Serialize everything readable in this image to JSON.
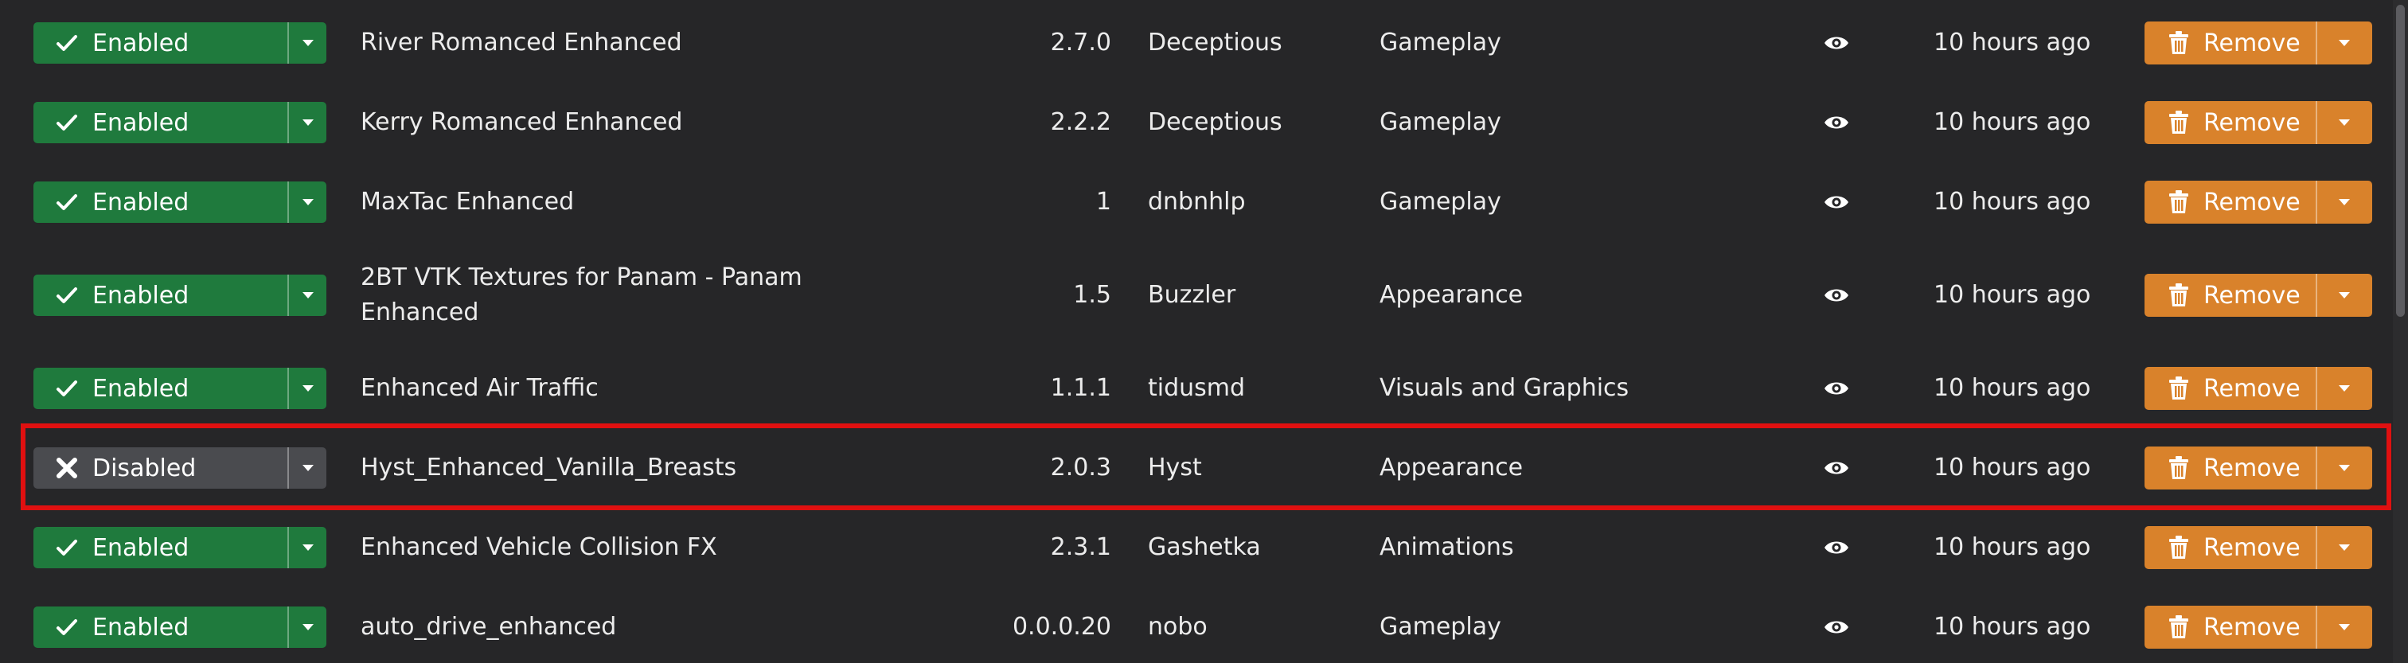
{
  "colors": {
    "background": "#262628",
    "enabled_green": "#1f7a3d",
    "disabled_gray": "#4a4b4f",
    "remove_orange": "#d9822b",
    "highlight_red": "#e01010"
  },
  "actions": {
    "remove_label": "Remove"
  },
  "mods": [
    {
      "status": "Enabled",
      "name": "River Romanced Enhanced",
      "version": "2.7.0",
      "author": "Deceptious",
      "category": "Gameplay",
      "updated": "10 hours ago"
    },
    {
      "status": "Enabled",
      "name": "Kerry Romanced Enhanced",
      "version": "2.2.2",
      "author": "Deceptious",
      "category": "Gameplay",
      "updated": "10 hours ago"
    },
    {
      "status": "Enabled",
      "name": "MaxTac Enhanced",
      "version": "1",
      "author": "dnbnhlp",
      "category": "Gameplay",
      "updated": "10 hours ago"
    },
    {
      "status": "Enabled",
      "name": "2BT VTK Textures for Panam - Panam Enhanced",
      "version": "1.5",
      "author": "Buzzler",
      "category": "Appearance",
      "updated": "10 hours ago"
    },
    {
      "status": "Enabled",
      "name": "Enhanced Air Traffic",
      "version": "1.1.1",
      "author": "tidusmd",
      "category": "Visuals and Graphics",
      "updated": "10 hours ago"
    },
    {
      "status": "Disabled",
      "name": "Hyst_Enhanced_Vanilla_Breasts",
      "version": "2.0.3",
      "author": "Hyst",
      "category": "Appearance",
      "updated": "10 hours ago"
    },
    {
      "status": "Enabled",
      "name": "Enhanced Vehicle Collision FX",
      "version": "2.3.1",
      "author": "Gashetka",
      "category": "Animations",
      "updated": "10 hours ago"
    },
    {
      "status": "Enabled",
      "name": "auto_drive_enhanced",
      "version": "0.0.0.20",
      "author": "nobo",
      "category": "Gameplay",
      "updated": "10 hours ago"
    }
  ]
}
